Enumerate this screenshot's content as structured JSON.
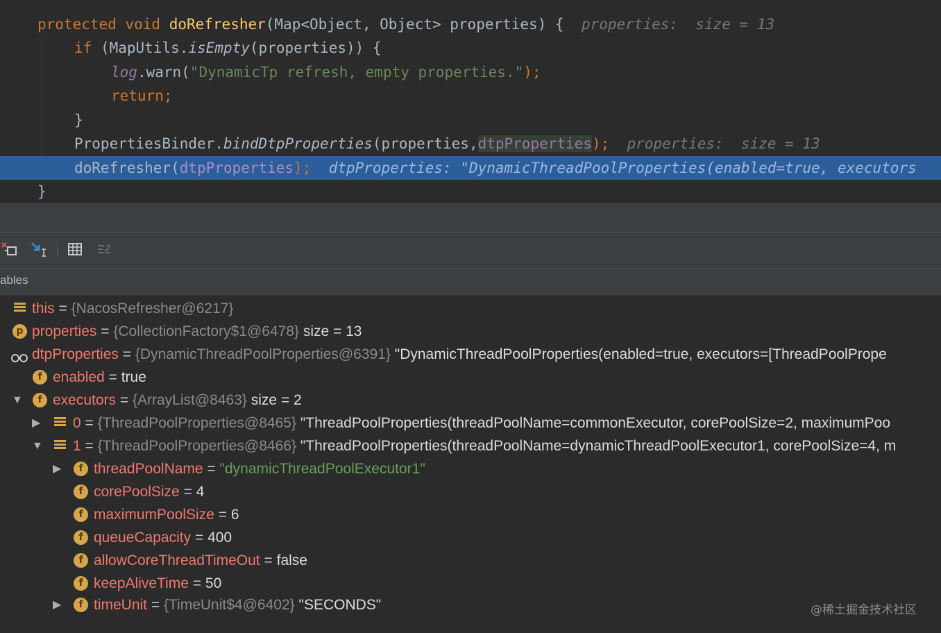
{
  "editor": {
    "line1": {
      "kw1": "protected",
      "kw2": "void",
      "method": "doRefresher",
      "params": "(Map<Object, Object> properties) {",
      "hint": "properties:  size = 13"
    },
    "line2": {
      "kw": "if",
      "open": "(MapUtils.",
      "call": "isEmpty",
      "rest": "(properties)) {"
    },
    "line3": {
      "obj": "log",
      "call": ".warn(",
      "str": "\"DynamicTp refresh, empty properties.\"",
      "end": ");"
    },
    "line4": {
      "kw": "return;"
    },
    "line5": {
      "text": "}"
    },
    "line6": {
      "cls": "PropertiesBinder.",
      "call": "bindDtpProperties",
      "args1": "(properties,",
      "field": "dtpProperties",
      "end": ");",
      "hint": "properties:  size = 13"
    },
    "line7": {
      "call": "doRefresher(",
      "field": "dtpProperties",
      "end": ");",
      "hint": "dtpProperties: \"DynamicThreadPoolProperties(enabled=true, executors"
    },
    "line8": {
      "text": "}"
    }
  },
  "toolbar": {
    "buttons": [
      "restore-layout-icon",
      "step-into-icon",
      "table-icon",
      "settings-list-icon"
    ]
  },
  "variables": {
    "title": "ables",
    "rows": [
      {
        "name": "this",
        "eq": "=",
        "ref": "{NacosRefresher@6217}",
        "val": ""
      },
      {
        "icon_letter": "p",
        "name": "properties",
        "eq": "=",
        "ref": "{CollectionFactory$1@6478}",
        "val": "size = 13"
      },
      {
        "name": "dtpProperties",
        "eq": "=",
        "ref": "{DynamicThreadPoolProperties@6391}",
        "val": "\"DynamicThreadPoolProperties(enabled=true, executors=[ThreadPoolPrope"
      },
      {
        "icon_letter": "f",
        "name": "enabled",
        "eq": "=",
        "val": "true"
      },
      {
        "arrow": "▼",
        "icon_letter": "f",
        "name": "executors",
        "eq": "=",
        "ref": "{ArrayList@8463}",
        "val": "size = 2"
      },
      {
        "arrow": "▶",
        "name": "0",
        "eq": "=",
        "ref": "{ThreadPoolProperties@8465}",
        "val": "\"ThreadPoolProperties(threadPoolName=commonExecutor, corePoolSize=2, maximumPoo"
      },
      {
        "arrow": "▼",
        "name": "1",
        "eq": "=",
        "ref": "{ThreadPoolProperties@8466}",
        "val": "\"ThreadPoolProperties(threadPoolName=dynamicThreadPoolExecutor1, corePoolSize=4, m"
      },
      {
        "arrow": "▶",
        "icon_letter": "f",
        "name": "threadPoolName",
        "eq": "=",
        "sval": "\"dynamicThreadPoolExecutor1\""
      },
      {
        "icon_letter": "f",
        "name": "corePoolSize",
        "eq": "=",
        "val": "4"
      },
      {
        "icon_letter": "f",
        "name": "maximumPoolSize",
        "eq": "=",
        "val": "6"
      },
      {
        "icon_letter": "f",
        "name": "queueCapacity",
        "eq": "=",
        "val": "400"
      },
      {
        "icon_letter": "f",
        "name": "allowCoreThreadTimeOut",
        "eq": "=",
        "val": "false"
      },
      {
        "icon_letter": "f",
        "name": "keepAliveTime",
        "eq": "=",
        "val": "50"
      },
      {
        "arrow": "▶",
        "icon_letter": "f",
        "name": "timeUnit",
        "eq": "=",
        "ref": "{TimeUnit$4@6402}",
        "val": "\"SECONDS\""
      }
    ]
  },
  "watermark": "@稀土掘金技术社区"
}
